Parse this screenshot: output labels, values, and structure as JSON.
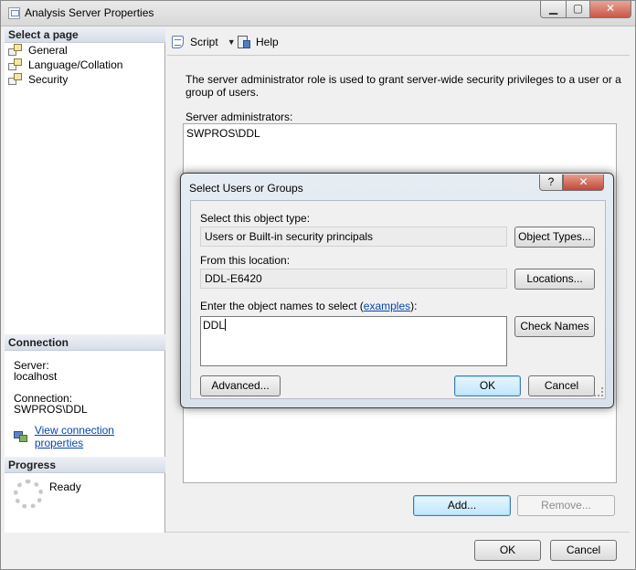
{
  "window": {
    "title": "Analysis Server Properties"
  },
  "left_pane": {
    "select_page_header": "Select a page",
    "pages": [
      {
        "label": "General"
      },
      {
        "label": "Language/Collation"
      },
      {
        "label": "Security"
      }
    ],
    "connection_header": "Connection",
    "server_label": "Server:",
    "server_value": "localhost",
    "connection_label": "Connection:",
    "connection_value": "SWPROS\\DDL",
    "view_connection_link": "View connection properties",
    "progress_header": "Progress",
    "progress_status": "Ready"
  },
  "toolbar": {
    "script_label": "Script",
    "help_label": "Help"
  },
  "security_page": {
    "description": "The server administrator role is used to grant server-wide security privileges to a user or a group of users.",
    "admins_label": "Server administrators:",
    "admins": [
      "SWPROS\\DDL"
    ],
    "add_button": "Add...",
    "remove_button": "Remove..."
  },
  "footer": {
    "ok_button": "OK",
    "cancel_button": "Cancel"
  },
  "dialog": {
    "title": "Select Users or Groups",
    "help_glyph": "?",
    "close_glyph": "✕",
    "object_type_label": "Select this object type:",
    "object_type_value": "Users or Built-in security principals",
    "object_types_button": "Object Types...",
    "location_label": "From this location:",
    "location_value": "DDL-E6420",
    "locations_button": "Locations...",
    "names_label_prefix": "Enter the object names to select (",
    "names_label_link": "examples",
    "names_label_suffix": "):",
    "names_value": "DDL",
    "check_names_button": "Check Names",
    "advanced_button": "Advanced...",
    "ok_button": "OK",
    "cancel_button": "Cancel"
  },
  "colors": {
    "link": "#0645ad",
    "dialog_frame": "#d9e2ec",
    "close_button": "#c34738"
  }
}
